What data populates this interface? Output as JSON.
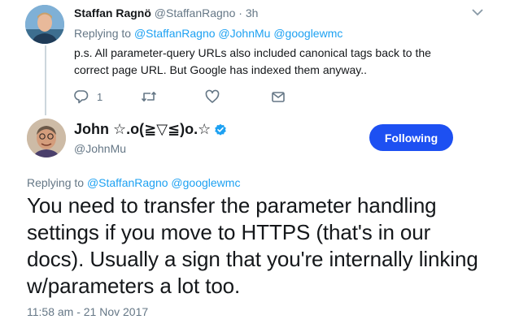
{
  "reply_tweet": {
    "name": "Staffan Ragnö",
    "handle": "@StaffanRagno",
    "separator": "·",
    "time": "3h",
    "replying_prefix": "Replying to",
    "replying_to": [
      "@StaffanRagno",
      "@JohnMu",
      "@googlewmc"
    ],
    "text": "p.s. All parameter-query URLs also included canonical tags back to the correct page URL. But Google has indexed them anyway..",
    "actions": {
      "reply_count": "1",
      "icons": [
        "reply-icon",
        "retweet-icon",
        "like-icon",
        "dm-icon"
      ]
    }
  },
  "main_tweet": {
    "name": "John ☆.o(≧▽≦)o.☆",
    "handle": "@JohnMu",
    "follow_label": "Following",
    "replying_prefix": "Replying to",
    "replying_to": [
      "@StaffanRagno",
      "@googlewmc"
    ],
    "text": "You need to transfer the parameter handling settings if you move to HTTPS (that's in our docs). Usually a sign that you're internally linking w/parameters a lot too.",
    "timestamp": "11:58 am - 21 Nov 2017"
  },
  "colors": {
    "link": "#1da1f2",
    "follow_button": "#1d50f2",
    "muted": "#657786",
    "verified": "#1da1f2"
  }
}
